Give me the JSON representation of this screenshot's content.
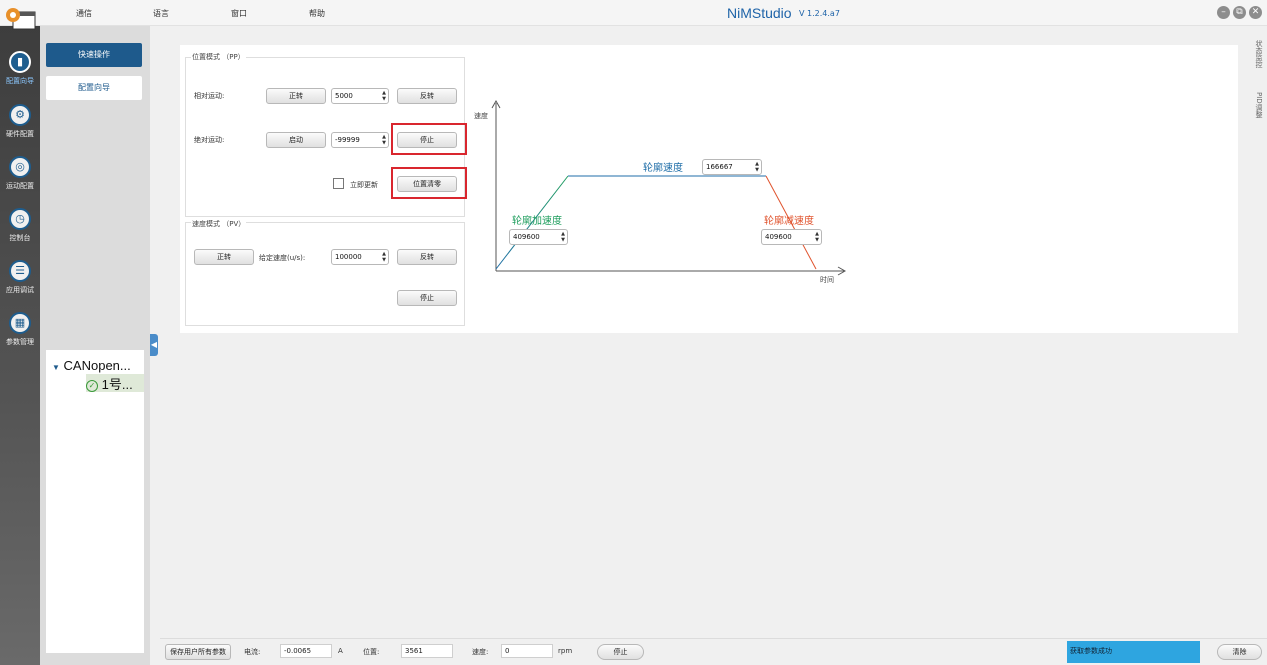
{
  "menu": [
    "通信",
    "语言",
    "窗口",
    "帮助"
  ],
  "app": {
    "title": "NiMStudio",
    "version": "V 1.2.4.a7"
  },
  "window_controls": {
    "minimize": "–",
    "restore": "⧉",
    "close": "✕"
  },
  "rail": [
    {
      "label": "配置向导",
      "icon": "wizard-icon",
      "active": true
    },
    {
      "label": "硬件配置",
      "icon": "hardware-icon",
      "active": false
    },
    {
      "label": "运动配置",
      "icon": "motion-icon",
      "active": false
    },
    {
      "label": "控制台",
      "icon": "console-icon",
      "active": false
    },
    {
      "label": "应用调试",
      "icon": "debug-icon",
      "active": false
    },
    {
      "label": "参数管理",
      "icon": "params-icon",
      "active": false
    }
  ],
  "side": {
    "quick_ops": "快速操作",
    "config_wizard": "配置向导"
  },
  "tree": {
    "root": "CANopen...",
    "child": "1号..."
  },
  "right_tabs": [
    "状态监控",
    "PID调整"
  ],
  "pp_mode": {
    "title": "位置模式 （PP）",
    "relative_label": "相对运动:",
    "forward": "正转",
    "relative_value": "5000",
    "reverse": "反转",
    "absolute_label": "绝对运动:",
    "start": "启动",
    "absolute_value": "-99999",
    "stop": "停止",
    "immediate_update": "立即更新",
    "immediate_checked": false,
    "position_clear": "位置清零"
  },
  "pv_mode": {
    "title": "速度模式 （PV）",
    "forward": "正转",
    "speed_label": "给定速度(u/s):",
    "speed_value": "100000",
    "reverse": "反转",
    "stop": "停止"
  },
  "profile_chart": {
    "y_axis": "速度",
    "x_axis": "时间",
    "profile_speed_label": "轮廓速度",
    "profile_speed_value": "166667",
    "accel_label": "轮廓加速度",
    "accel_value": "409600",
    "decel_label": "轮廓减速度",
    "decel_value": "409600",
    "colors": {
      "accel": "#1f9e5e",
      "decel": "#e0532d",
      "speed": "#1f6ea8"
    }
  },
  "statusbar": {
    "save_all": "保存用户所有参数",
    "current_label": "电流:",
    "current_value": "-0.0065",
    "current_unit": "A",
    "position_label": "位置:",
    "position_value": "3561",
    "speed_label": "速度:",
    "speed_value": "0",
    "speed_unit": "rpm",
    "stop": "停止",
    "message": "获取参数成功",
    "clear": "清除"
  }
}
